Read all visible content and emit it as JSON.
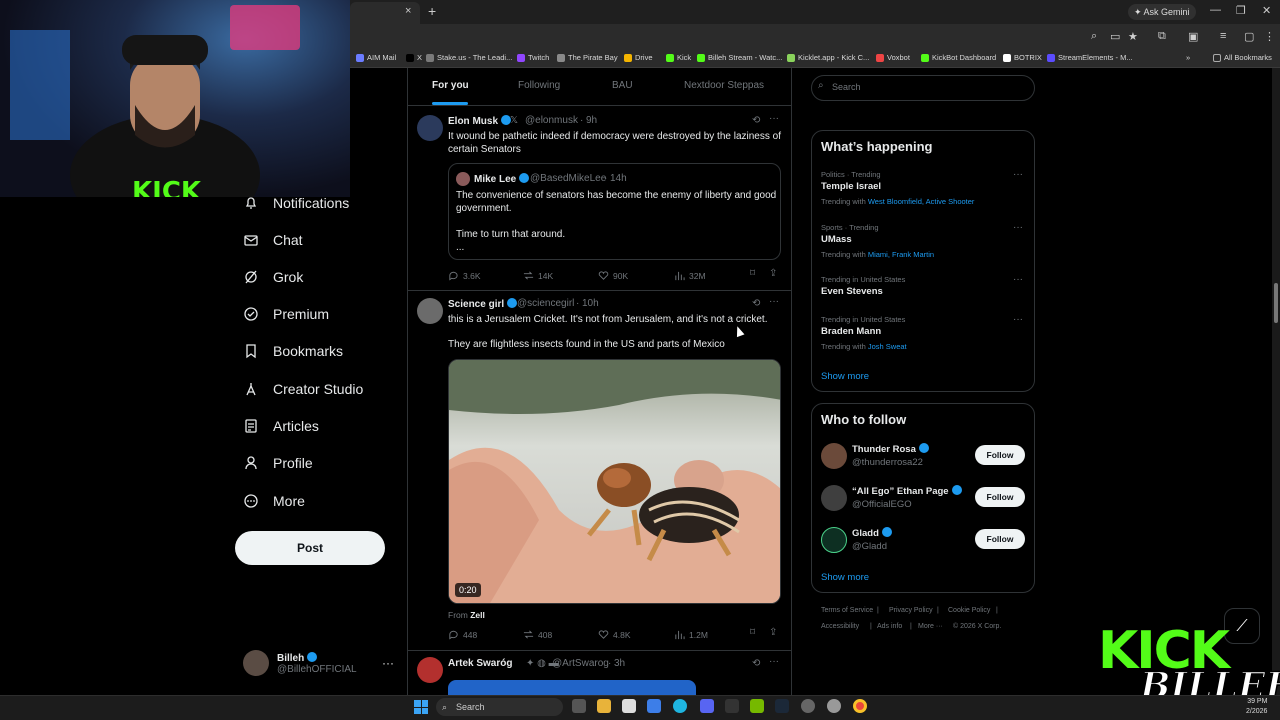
{
  "browser": {
    "tab_close": "×",
    "new_tab": "+",
    "ask_gemini": "Ask Gemini",
    "bookmarks": [
      {
        "label": "AIM Mail",
        "color": "#6b7cff"
      },
      {
        "label": "X",
        "color": "#000000"
      },
      {
        "label": "Stake.us - The Leadi...",
        "color": "#7a7a7a"
      },
      {
        "label": "Twitch",
        "color": "#9146ff"
      },
      {
        "label": "The Pirate Bay",
        "color": "#8a8a8a"
      },
      {
        "label": "Drive",
        "color": "#f4b400"
      },
      {
        "label": "Kick",
        "color": "#53fc18"
      },
      {
        "label": "Billeh Stream - Watc...",
        "color": "#53fc18"
      },
      {
        "label": "Kicklet.app - Kick C...",
        "color": "#8ad35c"
      },
      {
        "label": "Voxbot",
        "color": "#e44"
      },
      {
        "label": "KickBot Dashboard",
        "color": "#53fc18"
      },
      {
        "label": "BOTRIX",
        "color": "#ffffff"
      },
      {
        "label": "StreamElements - M...",
        "color": "#5b4cff"
      }
    ],
    "all_bookmarks": "All Bookmarks"
  },
  "nav": {
    "items": [
      {
        "label": "Notifications",
        "icon": "bell-icon"
      },
      {
        "label": "Chat",
        "icon": "mail-icon"
      },
      {
        "label": "Grok",
        "icon": "grok-icon"
      },
      {
        "label": "Premium",
        "icon": "verified-icon"
      },
      {
        "label": "Bookmarks",
        "icon": "bookmark-icon"
      },
      {
        "label": "Creator Studio",
        "icon": "creator-studio-icon"
      },
      {
        "label": "Articles",
        "icon": "articles-icon"
      },
      {
        "label": "Profile",
        "icon": "profile-icon"
      },
      {
        "label": "More",
        "icon": "more-circle-icon"
      }
    ],
    "post_label": "Post",
    "user": {
      "name": "Billeh",
      "handle": "@BillehOFFICIAL",
      "more": "···"
    }
  },
  "timeline": {
    "tabs": [
      "For you",
      "Following",
      "BAU",
      "Nextdoor Steppas"
    ],
    "active_tab": "For you",
    "tweets": [
      {
        "name": "Elon Musk",
        "handle": "@elonmusk",
        "time": "9h",
        "text": "It wound be pathetic indeed if democracy were destroyed by the laziness of certain Senators",
        "quote": {
          "name": "Mike Lee",
          "handle": "@BasedMikeLee",
          "time": "14h",
          "line1": "The convenience of senators has become the enemy of liberty and good government.",
          "line2": "Time to turn that around.",
          "line3": "..."
        },
        "replies": "3.6K",
        "reposts": "14K",
        "likes": "90K",
        "views": "32M"
      },
      {
        "name": "Science girl",
        "handle": "@sciencegirl",
        "time": "10h",
        "text": "this is a Jerusalem Cricket. It's not from Jerusalem, and it's not a cricket.",
        "text2": "They are flightless insects found in the US  and parts of Mexico",
        "video_time": "0:20",
        "from_prefix": "From",
        "from_name": "Zell",
        "replies": "448",
        "reposts": "408",
        "likes": "4.8K",
        "views": "1.2M"
      },
      {
        "name": "Artek Swaróg",
        "handle": "@ArtSwarog",
        "time": "3h"
      }
    ]
  },
  "sidebar": {
    "search_placeholder": "Search",
    "happening_title": "What’s happening",
    "trends": [
      {
        "category": "Politics · Trending",
        "name": "Temple Israel",
        "with_prefix": "Trending with",
        "with": "West Bloomfield, Active Shooter"
      },
      {
        "category": "Sports · Trending",
        "name": "UMass",
        "with_prefix": "Trending with",
        "with": "Miami, Frank Martin"
      },
      {
        "category": "Trending in United States",
        "name": "Even Stevens",
        "with_prefix": "",
        "with": ""
      },
      {
        "category": "Trending in United States",
        "name": "Braden Mann",
        "with_prefix": "Trending with",
        "with": "Josh Sweat"
      }
    ],
    "show_more": "Show more",
    "who_title": "Who to follow",
    "follow": [
      {
        "name": "Thunder Rosa",
        "handle": "@thunderrosa22",
        "button": "Follow"
      },
      {
        "name": "“All Ego” Ethan Page",
        "handle": "@OfficialEGO",
        "button": "Follow"
      },
      {
        "name": "Gladd",
        "handle": "@Gladd",
        "button": "Follow"
      }
    ],
    "footer": [
      "Terms of Service",
      "|",
      "Privacy Policy",
      "|",
      "Cookie Policy",
      "|",
      "Accessibility",
      "|",
      "Ads info",
      "|",
      "More ···",
      "© 2026 X Corp."
    ]
  },
  "overlay": {
    "kick": "KICK",
    "billeh": "BILLEH"
  },
  "taskbar": {
    "search": "Search",
    "time": "39 PM",
    "date": "2/2026"
  }
}
